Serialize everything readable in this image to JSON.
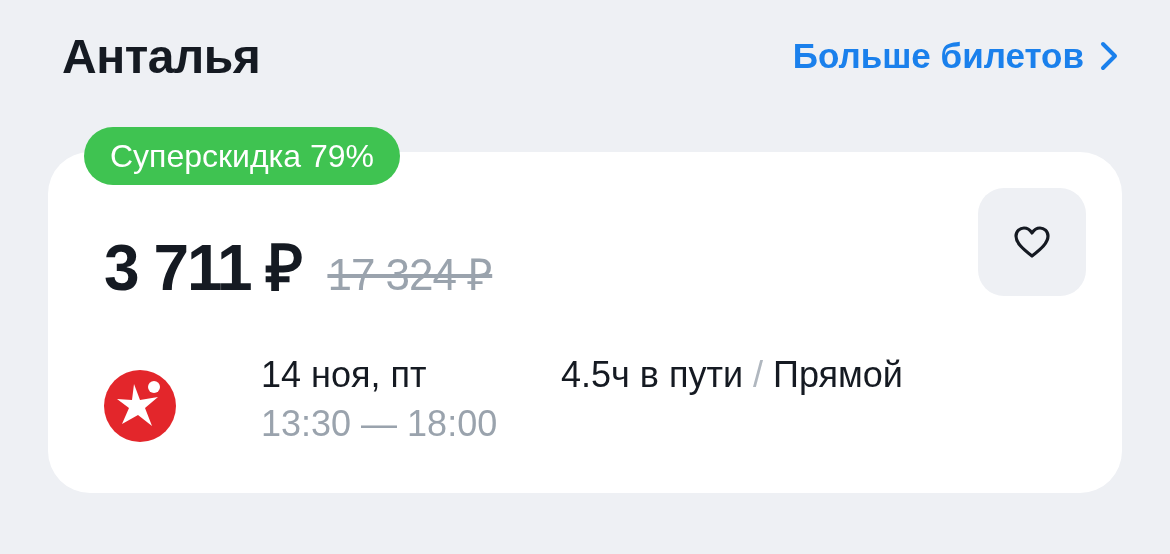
{
  "title": "Анталья",
  "more_link": "Больше билетов",
  "badge": "Суперскидка 79%",
  "price": "3 711 ₽",
  "old_price": "17 324 ₽",
  "favorite": false,
  "flight": {
    "date": "14 ноя, пт",
    "departure": "13:30",
    "time_separator": "—",
    "arrival": "18:00",
    "duration": "4.5ч в пути",
    "separator": "/",
    "type": "Прямой"
  }
}
